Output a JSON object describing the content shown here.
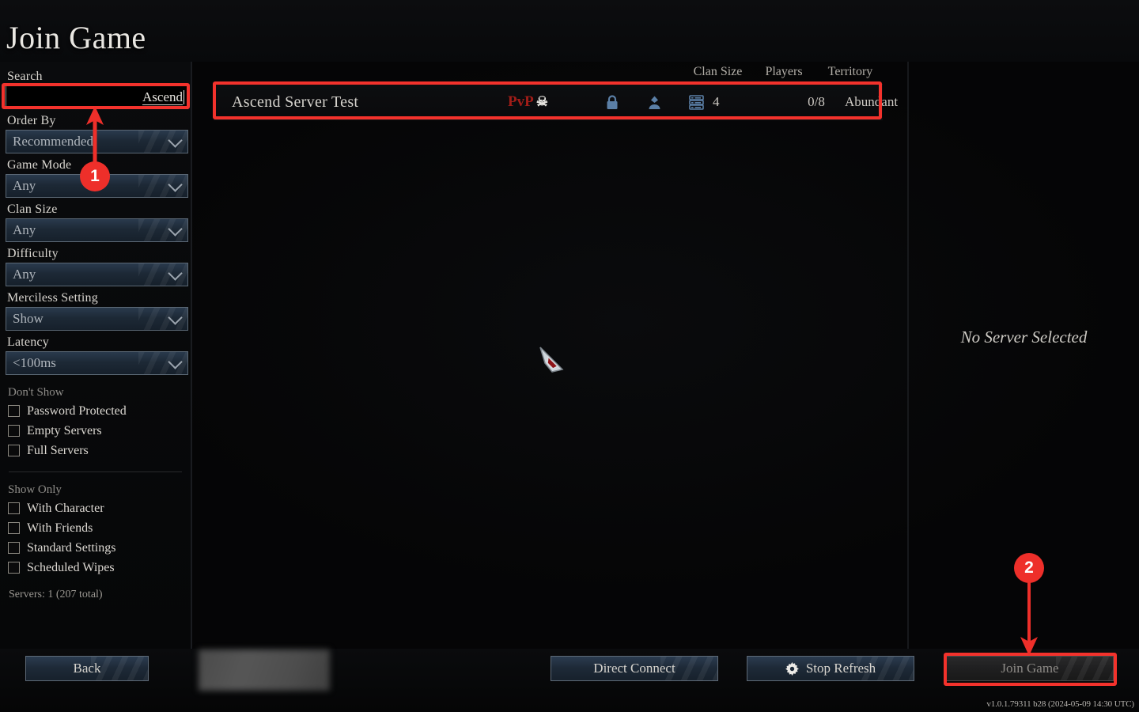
{
  "header": {
    "title": "Join Game"
  },
  "sidebar": {
    "search": {
      "label": "Search",
      "value": "Ascend",
      "placeholder": "Search"
    },
    "filters": [
      {
        "label": "Order By",
        "value": "Recommended"
      },
      {
        "label": "Game Mode",
        "value": "Any"
      },
      {
        "label": "Clan Size",
        "value": "Any"
      },
      {
        "label": "Difficulty",
        "value": "Any"
      },
      {
        "label": "Merciless Setting",
        "value": "Show"
      },
      {
        "label": "Latency",
        "value": "<100ms"
      }
    ],
    "dont_show": {
      "title": "Don't Show",
      "items": [
        {
          "label": "Password Protected",
          "checked": false
        },
        {
          "label": "Empty Servers",
          "checked": false
        },
        {
          "label": "Full Servers",
          "checked": false
        }
      ]
    },
    "show_only": {
      "title": "Show Only",
      "items": [
        {
          "label": "With Character",
          "checked": false
        },
        {
          "label": "With Friends",
          "checked": false
        },
        {
          "label": "Standard Settings",
          "checked": false
        },
        {
          "label": "Scheduled Wipes",
          "checked": false
        }
      ]
    },
    "server_count": "Servers: 1 (207 total)"
  },
  "list": {
    "columns": {
      "clan_size": "Clan Size",
      "players": "Players",
      "territory": "Territory"
    },
    "rows": [
      {
        "name": "Ascend Server Test",
        "mode": "PvP",
        "mode_icon": "skull-icon",
        "icons": [
          "lock-icon",
          "person-icon",
          "server-rack-icon"
        ],
        "clan_size": "4",
        "players": "0/8",
        "territory": "Abundant"
      }
    ]
  },
  "detail": {
    "empty_text": "No Server Selected"
  },
  "bottom": {
    "back_label": "Back",
    "direct_connect_label": "Direct Connect",
    "stop_refresh_label": "Stop Refresh",
    "stop_refresh_icon": "gear-icon",
    "join_game_label": "Join Game",
    "version": "v1.0.1.79311 b28 (2024-05-09 14:30 UTC)"
  },
  "annotations": {
    "markers": [
      {
        "number": "1",
        "target": "search-input"
      },
      {
        "number": "2",
        "target": "join-game-button"
      }
    ],
    "accent_color": "#ee2f2a"
  }
}
